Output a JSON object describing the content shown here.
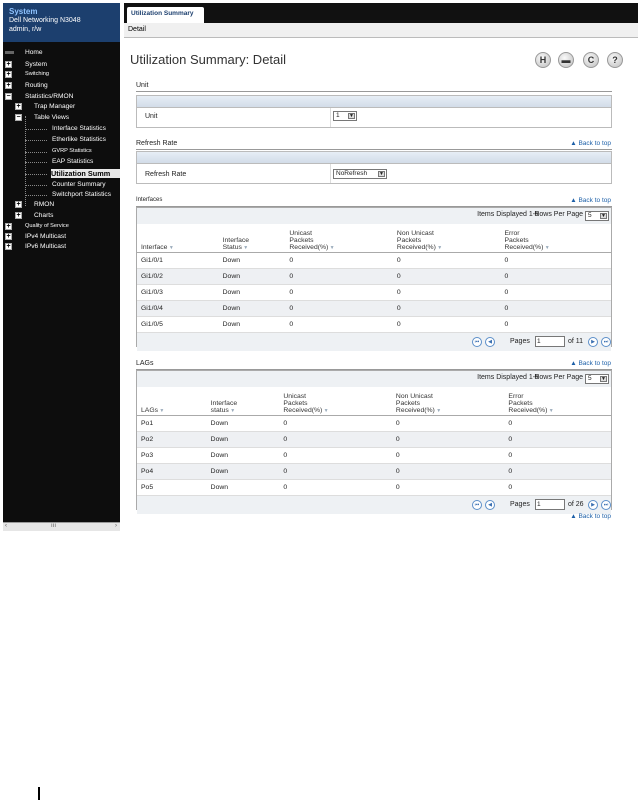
{
  "system": {
    "title": "System",
    "device": "Dell Networking N3048",
    "user": "admin, r/w"
  },
  "nav": [
    {
      "label": "Home",
      "level": 0,
      "icon": "home-icon",
      "small": false
    },
    {
      "label": "System",
      "level": 0,
      "icon": "expand-icon",
      "small": false
    },
    {
      "label": "Switching",
      "level": 0,
      "icon": "expand-icon",
      "small": true
    },
    {
      "label": "Routing",
      "level": 0,
      "icon": "expand-icon",
      "small": false
    },
    {
      "label": "Statistics/RMON",
      "level": 0,
      "icon": "collapse-icon",
      "small": false
    },
    {
      "label": "Trap Manager",
      "level": 1,
      "icon": "expand-icon",
      "small": false
    },
    {
      "label": "Table Views",
      "level": 1,
      "icon": "collapse-icon",
      "small": false
    },
    {
      "label": "Interface Statistics",
      "level": 2,
      "icon": "",
      "small": false
    },
    {
      "label": "Etherlike Statistics",
      "level": 2,
      "icon": "",
      "small": false
    },
    {
      "label": "GVRP Statistics",
      "level": 2,
      "icon": "",
      "small": true
    },
    {
      "label": "EAP Statistics",
      "level": 2,
      "icon": "",
      "small": false
    },
    {
      "label": "Utilization Summ",
      "level": 2,
      "icon": "",
      "small": false,
      "selected": true
    },
    {
      "label": "Counter Summary",
      "level": 2,
      "icon": "",
      "small": false
    },
    {
      "label": "Switchport Statistics",
      "level": 2,
      "icon": "",
      "small": false
    },
    {
      "label": "RMON",
      "level": 1,
      "icon": "expand-icon",
      "small": false
    },
    {
      "label": "Charts",
      "level": 1,
      "icon": "expand-icon",
      "small": false
    },
    {
      "label": "Quality of Service",
      "level": 0,
      "icon": "expand-icon",
      "small": true
    },
    {
      "label": "IPv4 Multicast",
      "level": 0,
      "icon": "expand-icon",
      "small": false
    },
    {
      "label": "IPv6 Multicast",
      "level": 0,
      "icon": "expand-icon",
      "small": false
    }
  ],
  "tab": {
    "label": "Utilization Summary"
  },
  "subtab": {
    "label": "Detail"
  },
  "page": {
    "title": "Utilization Summary: Detail"
  },
  "toolbar": {
    "save": "H",
    "print": "▬",
    "refresh": "C",
    "help": "?"
  },
  "unit_section": {
    "title": "Unit",
    "field_label": "Unit",
    "value": "1"
  },
  "refresh_section": {
    "title": "Refresh Rate",
    "field_label": "Refresh Rate",
    "value": "NoRefresh"
  },
  "back_to_top": "▲ Back to top",
  "interfaces": {
    "title": "Interfaces",
    "items_displayed": "Items Displayed 1-5",
    "rows_per_page_label": "Rows Per Page",
    "rows_per_page": "5",
    "columns": [
      {
        "line1": "",
        "line2": "",
        "line3": "Interface"
      },
      {
        "line1": "",
        "line2": "Interface",
        "line3": "Status"
      },
      {
        "line1": "Unicast",
        "line2": "Packets",
        "line3": "Received(%)"
      },
      {
        "line1": "Non Unicast",
        "line2": "Packets",
        "line3": "Received(%)"
      },
      {
        "line1": "Error",
        "line2": "Packets",
        "line3": "Received(%)"
      }
    ],
    "rows": [
      [
        "Gi1/0/1",
        "Down",
        "0",
        "0",
        "0"
      ],
      [
        "Gi1/0/2",
        "Down",
        "0",
        "0",
        "0"
      ],
      [
        "Gi1/0/3",
        "Down",
        "0",
        "0",
        "0"
      ],
      [
        "Gi1/0/4",
        "Down",
        "0",
        "0",
        "0"
      ],
      [
        "Gi1/0/5",
        "Down",
        "0",
        "0",
        "0"
      ]
    ],
    "pages_label": "Pages",
    "page": "1",
    "of_label": "of 11"
  },
  "lags": {
    "title": "LAGs",
    "items_displayed": "Items Displayed 1-5",
    "rows_per_page_label": "Rows Per Page",
    "rows_per_page": "5",
    "columns": [
      {
        "line1": "",
        "line2": "",
        "line3": "LAGs"
      },
      {
        "line1": "",
        "line2": "Interface",
        "line3": "status"
      },
      {
        "line1": "Unicast",
        "line2": "Packets",
        "line3": "Received(%)"
      },
      {
        "line1": "Non Unicast",
        "line2": "Packets",
        "line3": "Received(%)"
      },
      {
        "line1": "Error",
        "line2": "Packets",
        "line3": "Received(%)"
      }
    ],
    "rows": [
      [
        "Po1",
        "Down",
        "0",
        "0",
        "0"
      ],
      [
        "Po2",
        "Down",
        "0",
        "0",
        "0"
      ],
      [
        "Po3",
        "Down",
        "0",
        "0",
        "0"
      ],
      [
        "Po4",
        "Down",
        "0",
        "0",
        "0"
      ],
      [
        "Po5",
        "Down",
        "0",
        "0",
        "0"
      ]
    ],
    "pages_label": "Pages",
    "page": "1",
    "of_label": "of 26"
  },
  "scrollbar": {
    "left": "‹",
    "mid": "ııı",
    "right": "›"
  }
}
